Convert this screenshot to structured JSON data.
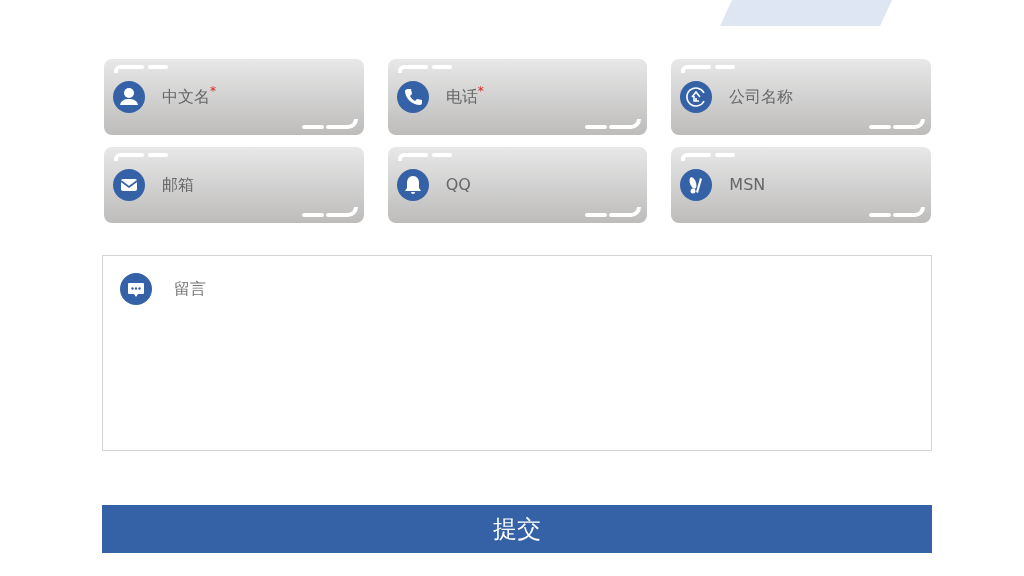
{
  "fields": [
    {
      "kind": "person",
      "placeholder": "中文名",
      "required_mark": "*"
    },
    {
      "kind": "phone",
      "placeholder": "电话",
      "required_mark": "*"
    },
    {
      "kind": "company",
      "placeholder": "公司名称"
    },
    {
      "kind": "mail",
      "placeholder": "邮箱"
    },
    {
      "kind": "bell",
      "placeholder": "QQ"
    },
    {
      "kind": "msn",
      "placeholder": "MSN"
    }
  ],
  "message": {
    "placeholder": "留言"
  },
  "submit": {
    "label": "提交"
  }
}
